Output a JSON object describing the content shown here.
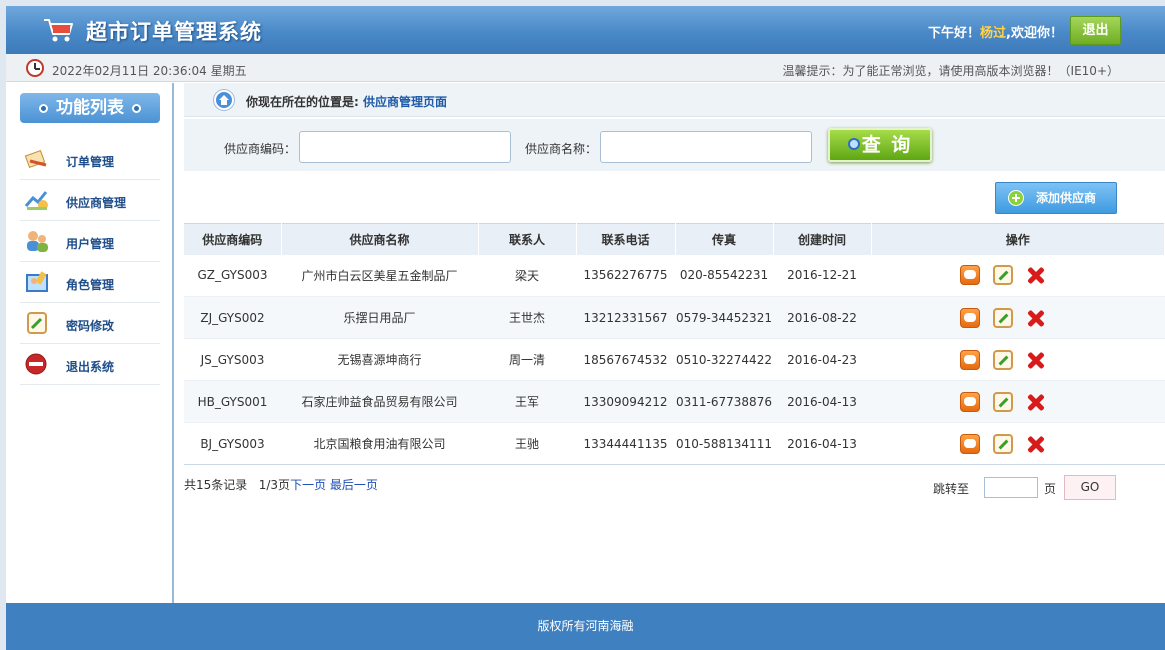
{
  "header": {
    "title": "超市订单管理系统",
    "greeting_prefix": "下午好！",
    "username": "杨过",
    "greeting_suffix": ",欢迎你！",
    "logout_label": "退出"
  },
  "subbar": {
    "datetime": "2022年02月11日 20:36:04 星期五",
    "tip": "温馨提示：为了能正常浏览，请使用高版本浏览器！（IE10+）"
  },
  "sidebar": {
    "heading": "功能列表",
    "items": [
      {
        "label": "订单管理",
        "icon": "order-icon"
      },
      {
        "label": "供应商管理",
        "icon": "provider-icon"
      },
      {
        "label": "用户管理",
        "icon": "users-icon"
      },
      {
        "label": "角色管理",
        "icon": "role-icon"
      },
      {
        "label": "密码修改",
        "icon": "password-icon"
      },
      {
        "label": "退出系统",
        "icon": "exit-icon"
      }
    ]
  },
  "breadcrumb": {
    "prefix": "你现在所在的位置是:",
    "current": "供应商管理页面"
  },
  "search": {
    "code_label": "供应商编码：",
    "code_value": "",
    "name_label": "供应商名称：",
    "name_value": "",
    "query_label": "查 询"
  },
  "add_button_label": "添加供应商",
  "table": {
    "columns": [
      "供应商编码",
      "供应商名称",
      "联系人",
      "联系电话",
      "传真",
      "创建时间",
      "操作"
    ],
    "rows": [
      {
        "code": "GZ_GYS003",
        "name": "广州市白云区美星五金制品厂",
        "contact": "梁天",
        "phone": "13562276775",
        "fax": "020-85542231",
        "created": "2016-12-21"
      },
      {
        "code": "ZJ_GYS002",
        "name": "乐摆日用品厂",
        "contact": "王世杰",
        "phone": "13212331567",
        "fax": "0579-34452321",
        "created": "2016-08-22"
      },
      {
        "code": "JS_GYS003",
        "name": "无锡喜源坤商行",
        "contact": "周一清",
        "phone": "18567674532",
        "fax": "0510-32274422",
        "created": "2016-04-23"
      },
      {
        "code": "HB_GYS001",
        "name": "石家庄帅益食品贸易有限公司",
        "contact": "王军",
        "phone": "13309094212",
        "fax": "0311-67738876",
        "created": "2016-04-13"
      },
      {
        "code": "BJ_GYS003",
        "name": "北京国粮食用油有限公司",
        "contact": "王驰",
        "phone": "13344441135",
        "fax": "010-588134111",
        "created": "2016-04-13"
      }
    ]
  },
  "pager": {
    "total": "共15条记录",
    "page_info": "1/3页",
    "next_label": "下一页",
    "last_label": "最后一页",
    "jump_label": "跳转至",
    "jump_value": "",
    "page_unit": "页",
    "go_label": "GO"
  },
  "footer": {
    "text": "版权所有河南海融"
  },
  "colors": {
    "header_blue": "#4a89c8",
    "footer_blue": "#3f80c1",
    "accent_green": "#6fae24",
    "link_blue": "#1f4fb4"
  }
}
